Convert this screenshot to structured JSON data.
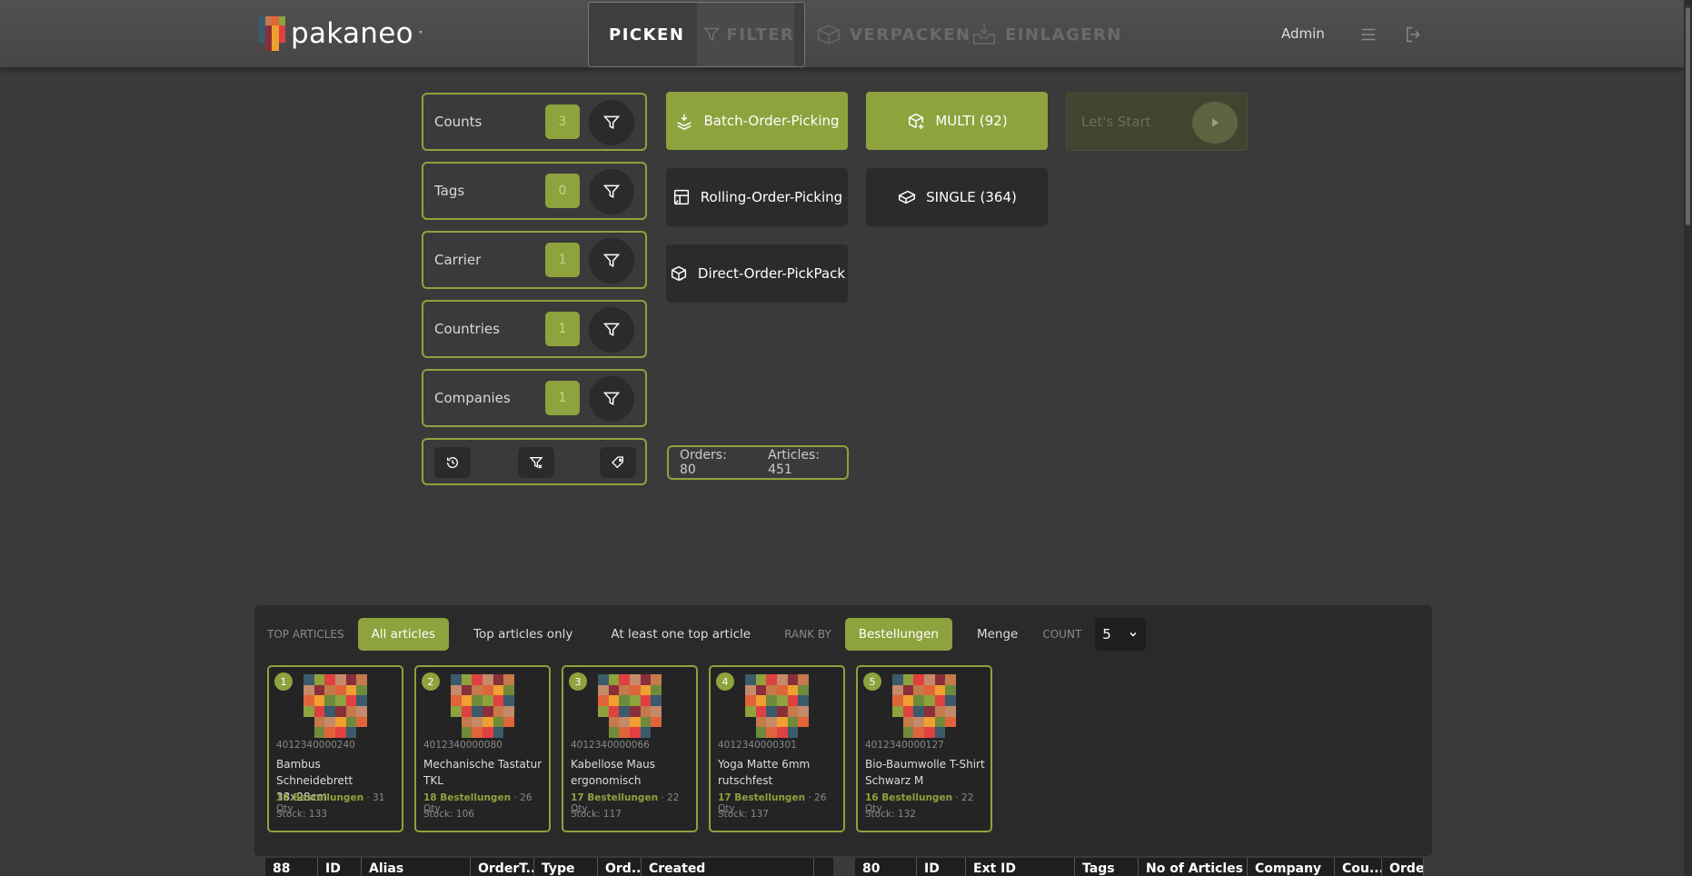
{
  "header": {
    "brand": "pakaneo",
    "nav": [
      {
        "label": "PICKEN",
        "icon": "cart-icon",
        "active": true
      },
      {
        "label": "FILTER",
        "icon": "filter-icon",
        "active": false
      },
      {
        "label": "VERPACKEN",
        "icon": "box-icon",
        "active": false
      },
      {
        "label": "EINLAGERN",
        "icon": "inbox-icon",
        "active": false
      }
    ],
    "user": "Admin",
    "accent": "#8ea23d"
  },
  "filters": [
    {
      "label": "Counts",
      "count": "3"
    },
    {
      "label": "Tags",
      "count": "0"
    },
    {
      "label": "Carrier",
      "count": "1"
    },
    {
      "label": "Countries",
      "count": "1"
    },
    {
      "label": "Companies",
      "count": "1"
    }
  ],
  "modes": {
    "batch": "Batch-Order-Picking",
    "rolling": "Rolling-Order-Picking",
    "direct": "Direct-Order-PickPack",
    "multi": "MULTI (92)",
    "single": "SINGLE (364)"
  },
  "start": {
    "label": "Let's Start"
  },
  "summary": {
    "orders": "Orders: 80",
    "articles": "Articles: 451"
  },
  "top_articles": {
    "caption": "TOP ARTICLES",
    "options": [
      "All articles",
      "Top articles only",
      "At least one top article"
    ],
    "rank_caption": "RANK BY",
    "rank_options": [
      "Bestellungen",
      "Menge"
    ],
    "count_caption": "COUNT",
    "count_value": "5",
    "cards": [
      {
        "rank": "1",
        "ean": "4012340000240",
        "name": "Bambus Schneidebrett 38x28cm",
        "orders": "19 Bestellungen",
        "qty": " · 31 Qty",
        "stock": "Stock: 133"
      },
      {
        "rank": "2",
        "ean": "4012340000080",
        "name": "Mechanische Tastatur TKL",
        "orders": "18 Bestellungen",
        "qty": " · 26 Qty",
        "stock": "Stock: 106"
      },
      {
        "rank": "3",
        "ean": "4012340000066",
        "name": "Kabellose Maus ergonomisch",
        "orders": "17 Bestellungen",
        "qty": " · 22 Qty",
        "stock": "Stock: 117"
      },
      {
        "rank": "4",
        "ean": "4012340000301",
        "name": "Yoga Matte 6mm rutschfest",
        "orders": "17 Bestellungen",
        "qty": " · 26 Qty",
        "stock": "Stock: 137"
      },
      {
        "rank": "5",
        "ean": "4012340000127",
        "name": "Bio-Baumwolle T-Shirt Schwarz M",
        "orders": "16 Bestellungen",
        "qty": " · 22 Qty",
        "stock": "Stock: 132"
      }
    ]
  },
  "table_left": {
    "columns": [
      "88",
      "ID",
      "Alias",
      "OrderT...",
      "Type",
      "Ord...",
      "Created"
    ]
  },
  "table_right": {
    "columns": [
      "80",
      "ID",
      "Ext ID",
      "Tags",
      "No of Articles",
      "Company",
      "Cou...",
      "Order"
    ]
  }
}
